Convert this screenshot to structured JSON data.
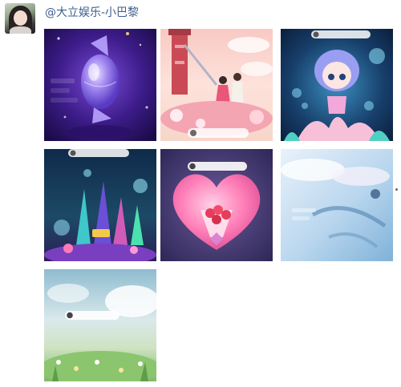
{
  "post": {
    "author": {
      "name": "@大立娱乐-小巴黎"
    },
    "images": [
      {
        "id": "img-candy"
      },
      {
        "id": "img-couple"
      },
      {
        "id": "img-mermaid"
      },
      {
        "id": "img-coral"
      },
      {
        "id": "img-heart"
      },
      {
        "id": "img-sky"
      },
      {
        "id": "img-meadow"
      }
    ]
  },
  "colors": {
    "username": "#3d5f8c",
    "background": "#ffffff"
  }
}
